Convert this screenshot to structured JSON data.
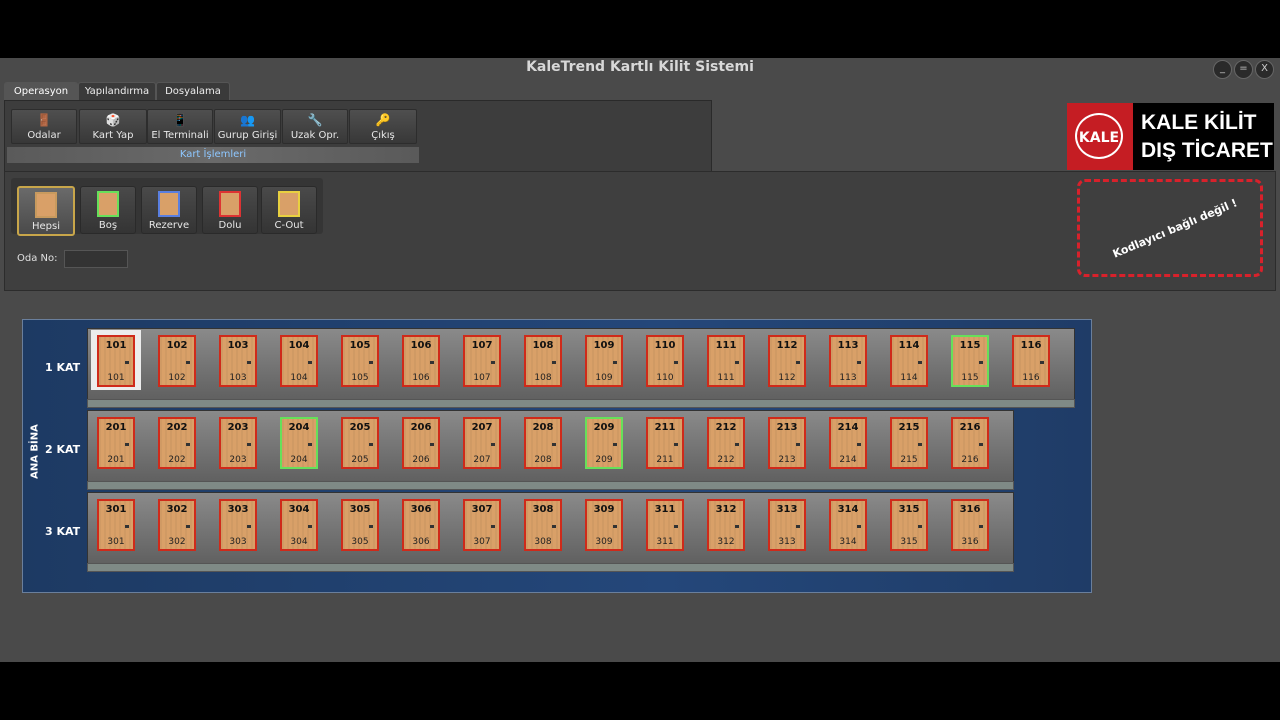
{
  "title": "KaleTrend Kartlı Kilit Sistemi",
  "window_buttons": [
    "_",
    "=",
    "X"
  ],
  "tabs": [
    "Operasyon",
    "Yapılandırma",
    "Dosyalama"
  ],
  "ribbon": {
    "buttons": [
      "Odalar",
      "Kart Yap",
      "El Terminali",
      "Gurup Girişi",
      "Uzak Opr.",
      "Çıkış"
    ],
    "group_label": "Kart İşlemleri"
  },
  "logo": {
    "line1": "KALE KİLİT",
    "line2": "DIŞ TİCARET",
    "emblem": "KALE"
  },
  "filters": [
    "Hepsi",
    "Boş",
    "Rezerve",
    "Dolu",
    "C-Out"
  ],
  "filter_colors": {
    "Hepsi": "#d33",
    "Boş": "#66e05a",
    "Rezerve": "#5a7fe0",
    "Dolu": "#d33",
    "C-Out": "#e8d040"
  },
  "odano_label": "Oda No:",
  "odano_value": "",
  "warning": "Kodlayıcı bağlı değil !",
  "building_name": "ANA BİNA",
  "floors": [
    {
      "label": "1 KAT",
      "rooms": [
        {
          "no": "101",
          "status": "dolu",
          "selected": true
        },
        {
          "no": "102",
          "status": "dolu"
        },
        {
          "no": "103",
          "status": "dolu"
        },
        {
          "no": "104",
          "status": "dolu"
        },
        {
          "no": "105",
          "status": "dolu"
        },
        {
          "no": "106",
          "status": "dolu"
        },
        {
          "no": "107",
          "status": "dolu"
        },
        {
          "no": "108",
          "status": "dolu"
        },
        {
          "no": "109",
          "status": "dolu"
        },
        {
          "no": "110",
          "status": "dolu"
        },
        {
          "no": "111",
          "status": "dolu"
        },
        {
          "no": "112",
          "status": "dolu"
        },
        {
          "no": "113",
          "status": "dolu"
        },
        {
          "no": "114",
          "status": "dolu"
        },
        {
          "no": "115",
          "status": "bos"
        },
        {
          "no": "116",
          "status": "dolu"
        }
      ]
    },
    {
      "label": "2 KAT",
      "rooms": [
        {
          "no": "201",
          "status": "dolu"
        },
        {
          "no": "202",
          "status": "dolu"
        },
        {
          "no": "203",
          "status": "dolu"
        },
        {
          "no": "204",
          "status": "bos"
        },
        {
          "no": "205",
          "status": "dolu"
        },
        {
          "no": "206",
          "status": "dolu"
        },
        {
          "no": "207",
          "status": "dolu"
        },
        {
          "no": "208",
          "status": "dolu"
        },
        {
          "no": "209",
          "status": "bos"
        },
        {
          "no": "211",
          "status": "dolu"
        },
        {
          "no": "212",
          "status": "dolu"
        },
        {
          "no": "213",
          "status": "dolu"
        },
        {
          "no": "214",
          "status": "dolu"
        },
        {
          "no": "215",
          "status": "dolu"
        },
        {
          "no": "216",
          "status": "dolu"
        }
      ]
    },
    {
      "label": "3 KAT",
      "rooms": [
        {
          "no": "301",
          "status": "dolu"
        },
        {
          "no": "302",
          "status": "dolu"
        },
        {
          "no": "303",
          "status": "dolu"
        },
        {
          "no": "304",
          "status": "dolu"
        },
        {
          "no": "305",
          "status": "dolu"
        },
        {
          "no": "306",
          "status": "dolu"
        },
        {
          "no": "307",
          "status": "dolu"
        },
        {
          "no": "308",
          "status": "dolu"
        },
        {
          "no": "309",
          "status": "dolu"
        },
        {
          "no": "311",
          "status": "dolu"
        },
        {
          "no": "312",
          "status": "dolu"
        },
        {
          "no": "313",
          "status": "dolu"
        },
        {
          "no": "314",
          "status": "dolu"
        },
        {
          "no": "315",
          "status": "dolu"
        },
        {
          "no": "316",
          "status": "dolu"
        }
      ]
    }
  ]
}
